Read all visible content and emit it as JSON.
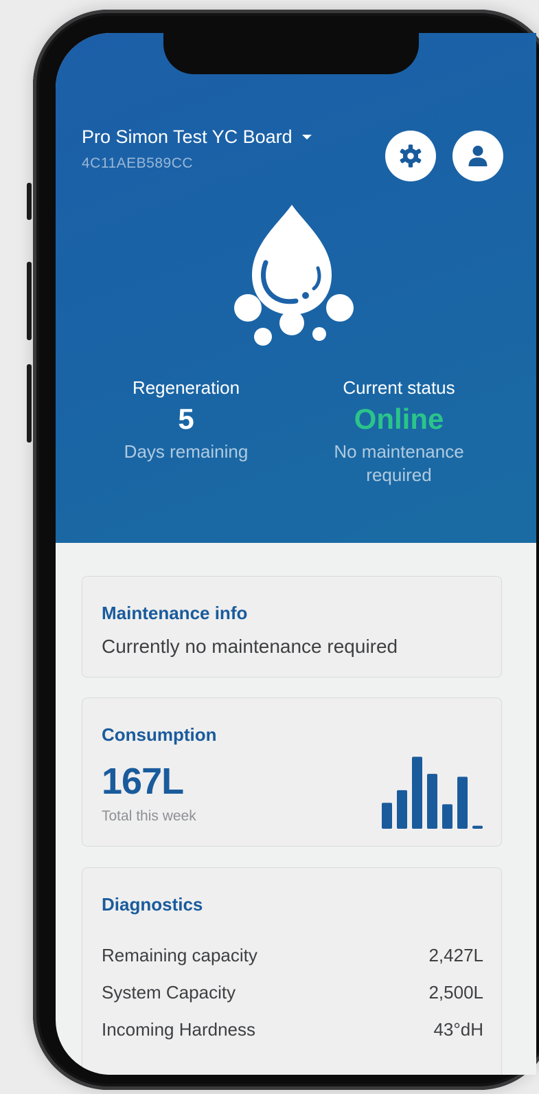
{
  "header": {
    "device_name": "Pro Simon Test YC Board",
    "device_id": "4C11AEB589CC",
    "icons": {
      "settings": "gear-icon",
      "profile": "user-icon",
      "device_selector": "caret-down-icon",
      "hero": "water-drop-icon"
    }
  },
  "stats": {
    "regeneration": {
      "label": "Regeneration",
      "value": "5",
      "sub": "Days remaining"
    },
    "status": {
      "label": "Current status",
      "value": "Online",
      "sub": "No maintenance required"
    }
  },
  "maintenance": {
    "title": "Maintenance info",
    "text": "Currently no maintenance required"
  },
  "consumption": {
    "title": "Consumption",
    "value": "167L",
    "caption": "Total this week",
    "bars": [
      0.35,
      0.52,
      0.97,
      0.74,
      0.33,
      0.7,
      0.04
    ]
  },
  "diagnostics": {
    "title": "Diagnostics",
    "rows": [
      {
        "label": "Remaining capacity",
        "value": "2,427L"
      },
      {
        "label": "System Capacity",
        "value": "2,500L"
      },
      {
        "label": "Incoming Hardness",
        "value": "43°dH"
      }
    ]
  },
  "colors": {
    "primary": "#1a5b9c",
    "online": "#2bc48a",
    "header_bg": "#1c62a8"
  }
}
